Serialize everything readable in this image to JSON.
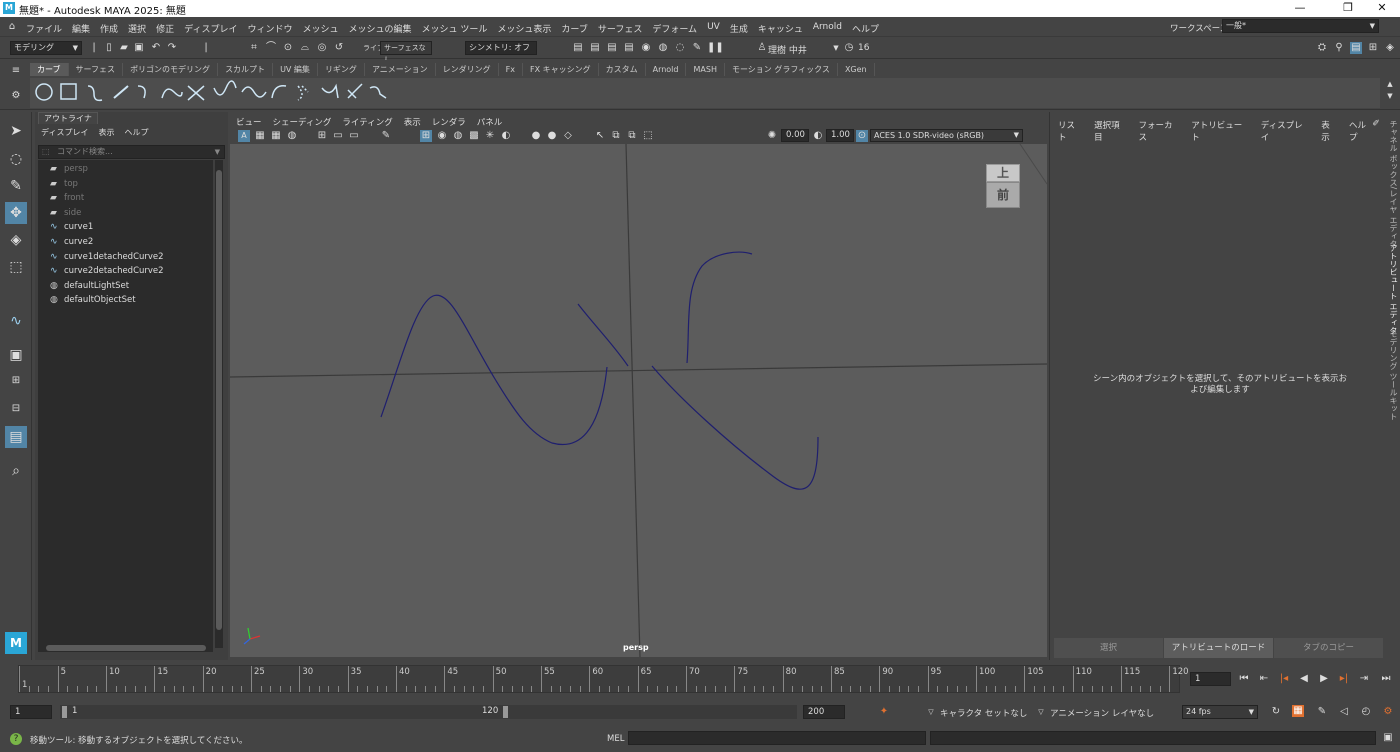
{
  "window": {
    "title": "無題* - Autodesk MAYA 2025: 無題",
    "logo": "M",
    "minimize": "—",
    "maximize": "❐",
    "close": "✕"
  },
  "menubar": {
    "home_icon": "home-icon",
    "items": [
      "ファイル",
      "編集",
      "作成",
      "選択",
      "修正",
      "ディスプレイ",
      "ウィンドウ",
      "メッシュ",
      "メッシュの編集",
      "メッシュ ツール",
      "メッシュ表示",
      "カーブ",
      "サーフェス",
      "デフォーム",
      "UV",
      "生成",
      "キャッシュ",
      "Arnold",
      "ヘルプ"
    ],
    "workspace_label": "ワークスペース:",
    "workspace_value": "一般*"
  },
  "statusline": {
    "mode": "モデリング",
    "live_label": "ライブ",
    "live_value": "サーフェスなし",
    "symmetry": "シンメトリ: オフ",
    "user": "理樹 中井",
    "notifications": "16"
  },
  "shelf": {
    "tabs": [
      "カーブ",
      "サーフェス",
      "ポリゴンのモデリング",
      "スカルプト",
      "UV 編集",
      "リギング",
      "アニメーション",
      "レンダリング",
      "Fx",
      "FX キャッシング",
      "カスタム",
      "Arnold",
      "MASH",
      "モーション グラフィックス",
      "XGen"
    ],
    "active_tab": "カーブ"
  },
  "outliner": {
    "tab": "アウトライナ",
    "menu": [
      "ディスプレイ",
      "表示",
      "ヘルプ"
    ],
    "search_placeholder": "コマンド検索...",
    "items": [
      {
        "name": "persp",
        "icon": "camera-icon",
        "dim": true
      },
      {
        "name": "top",
        "icon": "camera-icon",
        "dim": true
      },
      {
        "name": "front",
        "icon": "camera-icon",
        "dim": true
      },
      {
        "name": "side",
        "icon": "camera-icon",
        "dim": true
      },
      {
        "name": "curve1",
        "icon": "curve-icon",
        "dim": false
      },
      {
        "name": "curve2",
        "icon": "curve-icon",
        "dim": false
      },
      {
        "name": "curve1detachedCurve2",
        "icon": "curve-icon",
        "dim": false
      },
      {
        "name": "curve2detachedCurve2",
        "icon": "curve-icon",
        "dim": false
      },
      {
        "name": "defaultLightSet",
        "icon": "set-icon",
        "dim": false
      },
      {
        "name": "defaultObjectSet",
        "icon": "set-icon",
        "dim": false
      }
    ]
  },
  "viewport": {
    "menu": [
      "ビュー",
      "シェーディング",
      "ライティング",
      "表示",
      "レンダラ",
      "パネル"
    ],
    "exposure": "0.00",
    "gamma": "1.00",
    "color_space": "ACES 1.0 SDR-video (sRGB)",
    "camera_label": "persp",
    "viewcube_top": "上",
    "viewcube_front": "前"
  },
  "attribute_editor": {
    "menu": [
      "リスト",
      "選択項目",
      "フォーカス",
      "アトリビュート",
      "ディスプレイ",
      "表示",
      "ヘルプ"
    ],
    "message": "シーン内のオブジェクトを選択して、そのアトリビュートを表示および編集します",
    "buttons": [
      "選択",
      "アトリビュートのロード",
      "タブのコピー"
    ]
  },
  "side_tabs": [
    "チャネル ボックス/レイヤ エディタ",
    "アトリビュート エディタ",
    "モデリング ツールキット"
  ],
  "timeline": {
    "ticks": [
      "1",
      "5",
      "10",
      "15",
      "20",
      "25",
      "30",
      "35",
      "40",
      "45",
      "50",
      "55",
      "60",
      "65",
      "70",
      "75",
      "80",
      "85",
      "90",
      "95",
      "100",
      "105",
      "110",
      "115",
      "120"
    ],
    "current_frame": "1",
    "range_start": "1",
    "range_inner_start": "1",
    "range_inner_end": "120",
    "range_end": "200",
    "character_set": "キャラクタ セットなし",
    "anim_layer": "アニメーション レイヤなし",
    "fps": "24 fps"
  },
  "commandline": {
    "help": "移動ツール: 移動するオブジェクトを選択してください。",
    "lang": "MEL"
  }
}
